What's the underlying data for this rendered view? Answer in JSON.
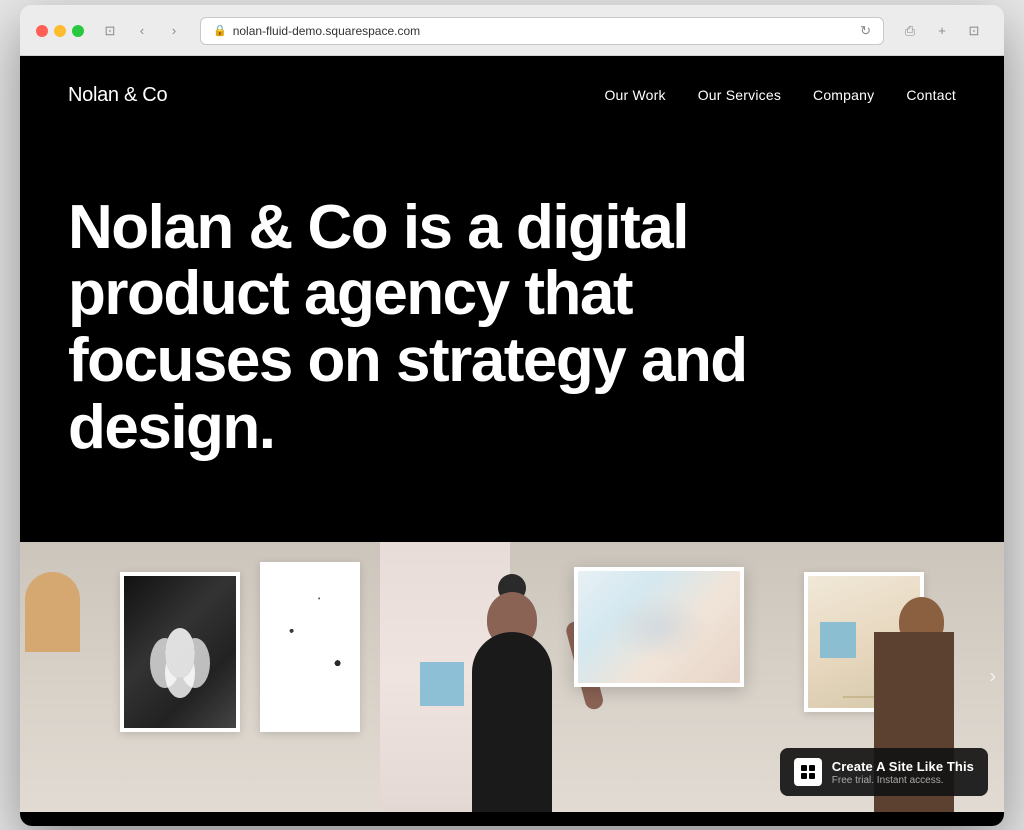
{
  "browser": {
    "url": "nolan-fluid-demo.squarespace.com",
    "tab_icon": "🔒"
  },
  "nav": {
    "logo": "Nolan & Co",
    "links": [
      {
        "label": "Our Work",
        "id": "our-work"
      },
      {
        "label": "Our Services",
        "id": "our-services"
      },
      {
        "label": "Company",
        "id": "company"
      },
      {
        "label": "Contact",
        "id": "contact"
      }
    ]
  },
  "hero": {
    "headline": "Nolan & Co is a digital product agency that focuses on strategy and design."
  },
  "badge": {
    "title": "Create A Site Like This",
    "subtitle": "Free trial. Instant access.",
    "logo_text": "◻"
  },
  "controls": {
    "back": "‹",
    "forward": "›",
    "window_icon": "⊡",
    "share": "⎙",
    "new_tab": "+",
    "sidebar": "⊡"
  }
}
